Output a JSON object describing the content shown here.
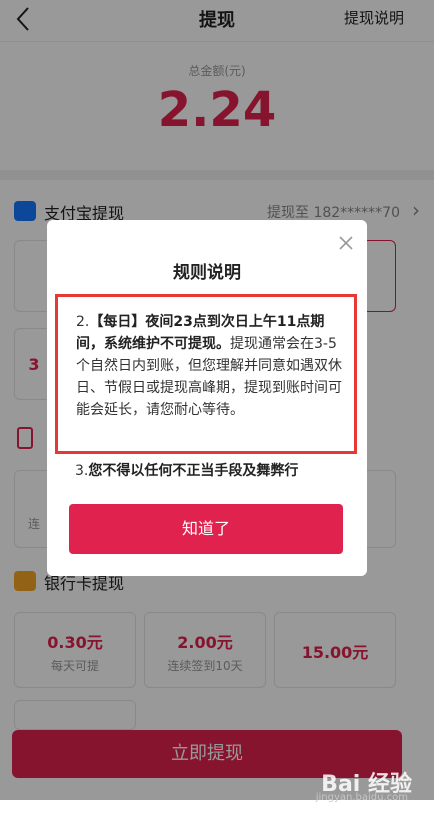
{
  "header": {
    "title": "提现",
    "help": "提现说明"
  },
  "summary": {
    "label": "总金额(元)",
    "value": "2.24"
  },
  "alipay": {
    "label": "支付宝提现",
    "target": "提现至 182******70",
    "chevron": "›"
  },
  "partials": {
    "left_amount": "3",
    "phone_hint": "连"
  },
  "bank": {
    "label": "银行卡提现",
    "options": [
      {
        "value": "0.30元",
        "sub": "每天可提"
      },
      {
        "value": "2.00元",
        "sub": "连续签到10天"
      },
      {
        "value": "15.00元",
        "sub": ""
      }
    ]
  },
  "submit_label": "立即提现",
  "modal": {
    "title": "规则说明",
    "rule2_prefix": "2.",
    "rule2_bold": "【每日】夜间23点到次日上午11点期间，系统维护不可提现。",
    "rule2_rest": "提现通常会在3-5个自然日内到账，但您理解并同意如遇双休日、节假日或提现高峰期，提现到账时间可能会延长，请您耐心等待。",
    "rule3_prefix": "3.",
    "rule3_bold": "您不得以任何不正当手段及舞弊行",
    "ok_label": "知道了"
  },
  "watermark": {
    "text": "Bai  经验",
    "url": "jingyan.baidu.com"
  },
  "colors": {
    "brand": "#e0224f",
    "highlight_border": "#e53935",
    "alipay": "#1677ff",
    "bank": "#f5a623"
  }
}
